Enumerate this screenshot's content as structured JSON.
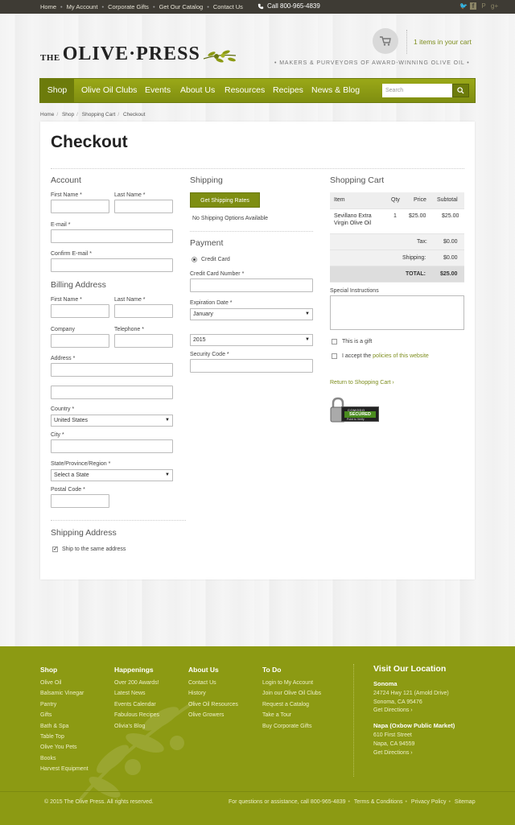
{
  "topbar": {
    "links": [
      "Home",
      "My Account",
      "Corporate Gifts",
      "Get Our Catalog",
      "Contact Us"
    ],
    "phone": "Call 800-965-4839"
  },
  "header": {
    "logo_the": "THE",
    "logo_name": "OLIVE·PRESS",
    "tagline": "• MAKERS & PURVEYORS OF AWARD-WINNING OLIVE OIL •",
    "cart_text": "1 items in your cart"
  },
  "nav": {
    "items": [
      "Shop",
      "Olive Oil Clubs",
      "Events",
      "About Us",
      "Resources",
      "Recipes",
      "News & Blog"
    ],
    "search_placeholder": "Search"
  },
  "breadcrumb": [
    "Home",
    "Shop",
    "Shopping Cart",
    "Checkout"
  ],
  "checkout": {
    "title": "Checkout",
    "account": {
      "heading": "Account",
      "first_name": "First Name *",
      "last_name": "Last Name *",
      "email": "E-mail *",
      "confirm_email": "Confirm E-mail *"
    },
    "billing": {
      "heading": "Billing Address",
      "first_name": "First Name *",
      "last_name": "Last Name *",
      "company": "Company",
      "telephone": "Telephone *",
      "address": "Address *",
      "country": "Country *",
      "country_value": "United States",
      "city": "City *",
      "state": "State/Province/Region *",
      "state_value": "Select a State",
      "postal": "Postal Code *"
    },
    "shipping_address": {
      "heading": "Shipping Address",
      "same": "Ship to the same address"
    },
    "shipping": {
      "heading": "Shipping",
      "button": "Get Shipping Rates",
      "none": "No Shipping Options Available"
    },
    "payment": {
      "heading": "Payment",
      "method": "Credit Card",
      "card_number": "Credit Card Number *",
      "exp": "Expiration Date *",
      "month": "January",
      "year": "2015",
      "security": "Security Code *"
    },
    "cart": {
      "heading": "Shopping Cart",
      "columns": [
        "Item",
        "Qty",
        "Price",
        "Subtotal"
      ],
      "item_name_1": "Sevillano Extra",
      "item_name_2": "Virgin Olive Oil",
      "qty": "1",
      "price": "$25.00",
      "subtotal": "$25.00",
      "tax_label": "Tax:",
      "tax": "$0.00",
      "shipping_label": "Shipping:",
      "shipping": "$0.00",
      "total_label": "TOTAL:",
      "total": "$25.00",
      "special": "Special Instructions",
      "gift": "This is a gift",
      "accept_pre": "I accept the",
      "accept_link": "policies of this website",
      "return": "Return to Shopping Cart ›",
      "badge_top": "COMODO",
      "badge_main": "SECURED",
      "badge_sub": "Point to Verify"
    }
  },
  "footer": {
    "cols": [
      {
        "title": "Shop",
        "items": [
          "Olive Oil",
          "Balsamic Vinegar",
          "Pantry",
          "Gifts",
          "Bath & Spa",
          "Table Top",
          "Olive You Pets",
          "Books",
          "Harvest Equipment"
        ]
      },
      {
        "title": "Happenings",
        "items": [
          "Over 200 Awards!",
          "Latest News",
          "Events Calendar",
          "Fabulous Recipes",
          "Olivia's Blog"
        ]
      },
      {
        "title": "About Us",
        "items": [
          "Contact Us",
          "History",
          "Olive Oil Resources",
          "Olive Growers"
        ]
      },
      {
        "title": "To Do",
        "items": [
          "Login to My Account",
          "Join our Olive Oil Clubs",
          "Request a Catalog",
          "Take a Tour",
          "Buy Corporate Gifts"
        ]
      }
    ],
    "visit": {
      "title": "Visit Our Location",
      "loc1": "Sonoma",
      "loc1_addr1": "24724 Hwy 121 (Arnold Drive)",
      "loc1_addr2": "Sonoma, CA 95476",
      "loc1_dir": "Get Directions ›",
      "loc2": "Napa (Oxbow Public Market)",
      "loc2_addr1": "610 First Street",
      "loc2_addr2": "Napa, CA 94559",
      "loc2_dir": "Get Directions ›"
    },
    "copyright": "© 2015 The Olive Press. All rights reserved.",
    "assist": "For questions or assistance, call 800-965-4839",
    "terms": "Terms & Conditions",
    "privacy": "Privacy Policy",
    "sitemap": "Sitemap"
  },
  "colors": {
    "brand_green": "#8c9a13",
    "nav_green": "#7f8e10",
    "topbar": "#3e3b34"
  }
}
